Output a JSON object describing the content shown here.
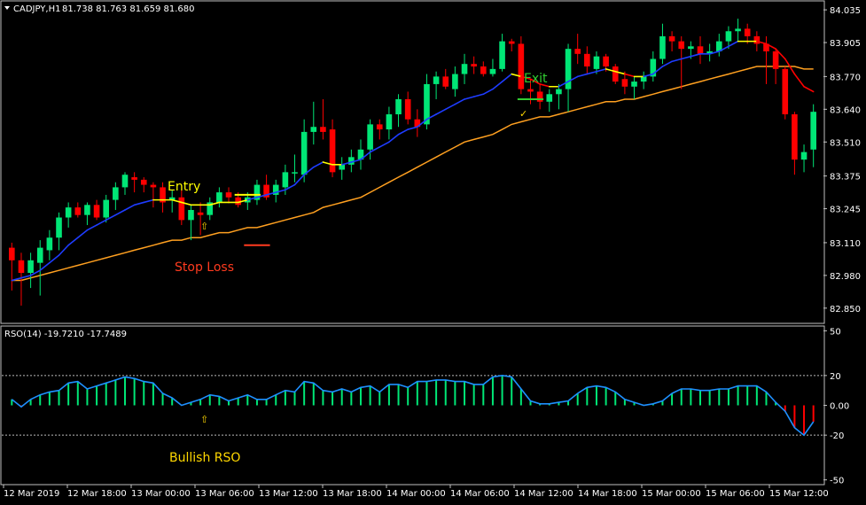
{
  "header": {
    "symbol": "CADJPY,H1",
    "ohlc": "81.738 81.763 81.659 81.680"
  },
  "indicator": {
    "title": "RSO(14) -19.7210 -17.7489"
  },
  "annotations": {
    "entry": "Entry",
    "exit": "Exit",
    "stop_loss": "Stop Loss",
    "bullish_rso": "Bullish RSO",
    "arrow_glyph": "⇧",
    "check_glyph": "✓"
  },
  "colors": {
    "background": "#000000",
    "bull": "#00E676",
    "bear": "#FF0000",
    "ma_fast_up": "#1E3CFF",
    "ma_fast_flat": "#FFFF00",
    "ma_fast_down": "#FF0000",
    "ma_slow": "#FFA020",
    "rso_line": "#1E90FF",
    "axis_text": "#FFFFFF",
    "entry_text": "#FFFF00",
    "exit_text": "#32CD32",
    "stop_text": "#FF3B1F",
    "bullish_rso_text": "#FFD700"
  },
  "chart_data": [
    {
      "type": "candlestick",
      "title": "CADJPY,H1 81.738 81.763 81.659 81.680",
      "y_ticks": [
        "84.035",
        "83.905",
        "83.770",
        "83.640",
        "83.510",
        "83.375",
        "83.245",
        "83.110",
        "82.980",
        "82.850"
      ],
      "ylim": [
        82.8,
        84.06
      ],
      "x_ticks": [
        "12 Mar 2019",
        "12 Mar 18:00",
        "13 Mar 00:00",
        "13 Mar 06:00",
        "13 Mar 12:00",
        "13 Mar 18:00",
        "14 Mar 00:00",
        "14 Mar 06:00",
        "14 Mar 12:00",
        "14 Mar 18:00",
        "15 Mar 00:00",
        "15 Mar 06:00",
        "15 Mar 12:00"
      ],
      "candles": [
        {
          "o": 83.09,
          "h": 83.11,
          "l": 82.92,
          "c": 83.04
        },
        {
          "o": 83.04,
          "h": 83.07,
          "l": 82.86,
          "c": 82.99
        },
        {
          "o": 82.99,
          "h": 83.07,
          "l": 82.93,
          "c": 83.04
        },
        {
          "o": 83.03,
          "h": 83.12,
          "l": 82.9,
          "c": 83.09
        },
        {
          "o": 83.08,
          "h": 83.16,
          "l": 83.04,
          "c": 83.13
        },
        {
          "o": 83.13,
          "h": 83.23,
          "l": 83.08,
          "c": 83.21
        },
        {
          "o": 83.21,
          "h": 83.27,
          "l": 83.17,
          "c": 83.25
        },
        {
          "o": 83.25,
          "h": 83.27,
          "l": 83.21,
          "c": 83.22
        },
        {
          "o": 83.22,
          "h": 83.27,
          "l": 83.18,
          "c": 83.26
        },
        {
          "o": 83.26,
          "h": 83.28,
          "l": 83.2,
          "c": 83.21
        },
        {
          "o": 83.21,
          "h": 83.3,
          "l": 83.19,
          "c": 83.28
        },
        {
          "o": 83.28,
          "h": 83.35,
          "l": 83.24,
          "c": 83.33
        },
        {
          "o": 83.33,
          "h": 83.39,
          "l": 83.3,
          "c": 83.38
        },
        {
          "o": 83.37,
          "h": 83.39,
          "l": 83.31,
          "c": 83.36
        },
        {
          "o": 83.36,
          "h": 83.37,
          "l": 83.31,
          "c": 83.34
        },
        {
          "o": 83.34,
          "h": 83.35,
          "l": 83.25,
          "c": 83.33
        },
        {
          "o": 83.33,
          "h": 83.35,
          "l": 83.23,
          "c": 83.27
        },
        {
          "o": 83.28,
          "h": 83.32,
          "l": 83.23,
          "c": 83.29
        },
        {
          "o": 83.29,
          "h": 83.32,
          "l": 83.18,
          "c": 83.2
        },
        {
          "o": 83.2,
          "h": 83.26,
          "l": 83.12,
          "c": 83.24
        },
        {
          "o": 83.23,
          "h": 83.27,
          "l": 83.14,
          "c": 83.22
        },
        {
          "o": 83.22,
          "h": 83.29,
          "l": 83.2,
          "c": 83.27
        },
        {
          "o": 83.27,
          "h": 83.33,
          "l": 83.25,
          "c": 83.31
        },
        {
          "o": 83.31,
          "h": 83.33,
          "l": 83.27,
          "c": 83.29
        },
        {
          "o": 83.29,
          "h": 83.31,
          "l": 83.25,
          "c": 83.26
        },
        {
          "o": 83.27,
          "h": 83.31,
          "l": 83.24,
          "c": 83.29
        },
        {
          "o": 83.28,
          "h": 83.36,
          "l": 83.26,
          "c": 83.34
        },
        {
          "o": 83.34,
          "h": 83.38,
          "l": 83.28,
          "c": 83.29
        },
        {
          "o": 83.3,
          "h": 83.36,
          "l": 83.27,
          "c": 83.34
        },
        {
          "o": 83.33,
          "h": 83.42,
          "l": 83.3,
          "c": 83.39
        },
        {
          "o": 83.39,
          "h": 83.46,
          "l": 83.35,
          "c": 83.39
        },
        {
          "o": 83.38,
          "h": 83.6,
          "l": 83.35,
          "c": 83.55
        },
        {
          "o": 83.55,
          "h": 83.67,
          "l": 83.5,
          "c": 83.57
        },
        {
          "o": 83.57,
          "h": 83.68,
          "l": 83.52,
          "c": 83.55
        },
        {
          "o": 83.56,
          "h": 83.6,
          "l": 83.37,
          "c": 83.39
        },
        {
          "o": 83.4,
          "h": 83.45,
          "l": 83.36,
          "c": 83.42
        },
        {
          "o": 83.42,
          "h": 83.48,
          "l": 83.39,
          "c": 83.45
        },
        {
          "o": 83.44,
          "h": 83.52,
          "l": 83.4,
          "c": 83.48
        },
        {
          "o": 83.48,
          "h": 83.6,
          "l": 83.44,
          "c": 83.58
        },
        {
          "o": 83.58,
          "h": 83.6,
          "l": 83.52,
          "c": 83.56
        },
        {
          "o": 83.56,
          "h": 83.65,
          "l": 83.52,
          "c": 83.62
        },
        {
          "o": 83.62,
          "h": 83.7,
          "l": 83.57,
          "c": 83.68
        },
        {
          "o": 83.68,
          "h": 83.71,
          "l": 83.58,
          "c": 83.6
        },
        {
          "o": 83.6,
          "h": 83.64,
          "l": 83.53,
          "c": 83.57
        },
        {
          "o": 83.58,
          "h": 83.78,
          "l": 83.56,
          "c": 83.74
        },
        {
          "o": 83.74,
          "h": 83.79,
          "l": 83.68,
          "c": 83.77
        },
        {
          "o": 83.77,
          "h": 83.8,
          "l": 83.72,
          "c": 83.73
        },
        {
          "o": 83.72,
          "h": 83.81,
          "l": 83.69,
          "c": 83.78
        },
        {
          "o": 83.78,
          "h": 83.86,
          "l": 83.74,
          "c": 83.82
        },
        {
          "o": 83.82,
          "h": 83.85,
          "l": 83.78,
          "c": 83.81
        },
        {
          "o": 83.81,
          "h": 83.83,
          "l": 83.77,
          "c": 83.78
        },
        {
          "o": 83.78,
          "h": 83.84,
          "l": 83.77,
          "c": 83.8
        },
        {
          "o": 83.8,
          "h": 83.94,
          "l": 83.79,
          "c": 83.91
        },
        {
          "o": 83.91,
          "h": 83.92,
          "l": 83.87,
          "c": 83.9
        },
        {
          "o": 83.9,
          "h": 83.93,
          "l": 83.7,
          "c": 83.72
        },
        {
          "o": 83.72,
          "h": 83.76,
          "l": 83.66,
          "c": 83.71
        },
        {
          "o": 83.71,
          "h": 83.74,
          "l": 83.64,
          "c": 83.67
        },
        {
          "o": 83.67,
          "h": 83.72,
          "l": 83.63,
          "c": 83.7
        },
        {
          "o": 83.7,
          "h": 83.74,
          "l": 83.64,
          "c": 83.72
        },
        {
          "o": 83.72,
          "h": 83.9,
          "l": 83.63,
          "c": 83.88
        },
        {
          "o": 83.88,
          "h": 83.94,
          "l": 83.82,
          "c": 83.86
        },
        {
          "o": 83.86,
          "h": 83.89,
          "l": 83.78,
          "c": 83.81
        },
        {
          "o": 83.8,
          "h": 83.87,
          "l": 83.78,
          "c": 83.85
        },
        {
          "o": 83.85,
          "h": 83.86,
          "l": 83.79,
          "c": 83.81
        },
        {
          "o": 83.81,
          "h": 83.82,
          "l": 83.74,
          "c": 83.75
        },
        {
          "o": 83.76,
          "h": 83.79,
          "l": 83.7,
          "c": 83.73
        },
        {
          "o": 83.73,
          "h": 83.77,
          "l": 83.68,
          "c": 83.75
        },
        {
          "o": 83.75,
          "h": 83.79,
          "l": 83.72,
          "c": 83.77
        },
        {
          "o": 83.77,
          "h": 83.87,
          "l": 83.75,
          "c": 83.84
        },
        {
          "o": 83.84,
          "h": 83.98,
          "l": 83.82,
          "c": 83.93
        },
        {
          "o": 83.93,
          "h": 83.95,
          "l": 83.87,
          "c": 83.91
        },
        {
          "o": 83.91,
          "h": 83.93,
          "l": 83.72,
          "c": 83.88
        },
        {
          "o": 83.88,
          "h": 83.91,
          "l": 83.84,
          "c": 83.89
        },
        {
          "o": 83.89,
          "h": 83.93,
          "l": 83.82,
          "c": 83.86
        },
        {
          "o": 83.86,
          "h": 83.9,
          "l": 83.83,
          "c": 83.87
        },
        {
          "o": 83.87,
          "h": 83.94,
          "l": 83.85,
          "c": 83.91
        },
        {
          "o": 83.91,
          "h": 83.97,
          "l": 83.88,
          "c": 83.95
        },
        {
          "o": 83.95,
          "h": 84.0,
          "l": 83.91,
          "c": 83.96
        },
        {
          "o": 83.96,
          "h": 83.98,
          "l": 83.9,
          "c": 83.93
        },
        {
          "o": 83.93,
          "h": 83.95,
          "l": 83.87,
          "c": 83.9
        },
        {
          "o": 83.9,
          "h": 83.93,
          "l": 83.74,
          "c": 83.87
        },
        {
          "o": 83.87,
          "h": 83.88,
          "l": 83.74,
          "c": 83.8
        },
        {
          "o": 83.8,
          "h": 83.81,
          "l": 83.6,
          "c": 83.62
        },
        {
          "o": 83.62,
          "h": 83.63,
          "l": 83.38,
          "c": 83.44
        },
        {
          "o": 83.44,
          "h": 83.5,
          "l": 83.39,
          "c": 83.47
        },
        {
          "o": 83.48,
          "h": 83.66,
          "l": 83.41,
          "c": 83.63
        }
      ],
      "ma_fast": [
        82.96,
        82.97,
        82.98,
        83.0,
        83.03,
        83.06,
        83.1,
        83.13,
        83.16,
        83.18,
        83.2,
        83.22,
        83.24,
        83.26,
        83.27,
        83.28,
        83.28,
        83.28,
        83.27,
        83.26,
        83.26,
        83.26,
        83.27,
        83.27,
        83.27,
        83.28,
        83.29,
        83.3,
        83.31,
        83.32,
        83.34,
        83.38,
        83.41,
        83.43,
        83.42,
        83.42,
        83.43,
        83.44,
        83.47,
        83.49,
        83.51,
        83.54,
        83.56,
        83.57,
        83.6,
        83.62,
        83.64,
        83.66,
        83.68,
        83.69,
        83.7,
        83.72,
        83.75,
        83.78,
        83.77,
        83.76,
        83.74,
        83.73,
        83.73,
        83.75,
        83.77,
        83.78,
        83.79,
        83.8,
        83.79,
        83.78,
        83.77,
        83.77,
        83.78,
        83.81,
        83.83,
        83.84,
        83.85,
        83.86,
        83.86,
        83.87,
        83.89,
        83.91,
        83.91,
        83.91,
        83.9,
        83.88,
        83.84,
        83.78,
        83.73,
        83.71
      ],
      "ma_fast_trend": [
        "up",
        "up",
        "up",
        "up",
        "up",
        "up",
        "up",
        "up",
        "up",
        "up",
        "up",
        "up",
        "up",
        "up",
        "up",
        "up",
        "flat",
        "flat",
        "flat",
        "flat",
        "flat",
        "flat",
        "flat",
        "flat",
        "flat",
        "flat",
        "up",
        "up",
        "up",
        "up",
        "up",
        "up",
        "up",
        "up",
        "flat",
        "flat",
        "up",
        "up",
        "up",
        "up",
        "up",
        "up",
        "up",
        "up",
        "up",
        "up",
        "up",
        "up",
        "up",
        "up",
        "up",
        "up",
        "up",
        "up",
        "flat",
        "down",
        "down",
        "down",
        "flat",
        "up",
        "up",
        "up",
        "up",
        "up",
        "flat",
        "flat",
        "down",
        "flat",
        "up",
        "up",
        "up",
        "up",
        "up",
        "up",
        "up",
        "up",
        "up",
        "up",
        "flat",
        "flat",
        "down",
        "down",
        "down",
        "down",
        "down",
        "down"
      ],
      "ma_slow": [
        82.96,
        82.96,
        82.97,
        82.98,
        82.99,
        83.0,
        83.01,
        83.02,
        83.03,
        83.04,
        83.05,
        83.06,
        83.07,
        83.08,
        83.09,
        83.1,
        83.11,
        83.12,
        83.12,
        83.13,
        83.13,
        83.14,
        83.15,
        83.15,
        83.16,
        83.17,
        83.17,
        83.18,
        83.19,
        83.2,
        83.21,
        83.22,
        83.23,
        83.25,
        83.26,
        83.27,
        83.28,
        83.29,
        83.31,
        83.33,
        83.35,
        83.37,
        83.39,
        83.41,
        83.43,
        83.45,
        83.47,
        83.49,
        83.51,
        83.52,
        83.53,
        83.54,
        83.56,
        83.58,
        83.59,
        83.6,
        83.61,
        83.61,
        83.62,
        83.63,
        83.64,
        83.65,
        83.66,
        83.67,
        83.67,
        83.68,
        83.68,
        83.69,
        83.7,
        83.71,
        83.72,
        83.73,
        83.74,
        83.75,
        83.76,
        83.77,
        83.78,
        83.79,
        83.8,
        83.81,
        83.81,
        83.81,
        83.81,
        83.81,
        83.8,
        83.8
      ],
      "annotation_lines": [
        {
          "label": "entry",
          "price": 83.3,
          "from": 24,
          "to": 26,
          "color": "#FFFF00"
        },
        {
          "label": "stop_loss",
          "price": 83.1,
          "from": 25,
          "to": 27,
          "color": "#FF3B1F"
        },
        {
          "label": "exit",
          "price": 83.68,
          "from": 54,
          "to": 56,
          "color": "#32CD32"
        }
      ]
    },
    {
      "type": "bar",
      "title": "RSO(14) -19.7210 -17.7489",
      "ylim": [
        -52,
        52
      ],
      "y_ticks": [
        "50",
        "20",
        "0.00",
        "-20",
        "-50"
      ],
      "levels": [
        20,
        -20
      ],
      "values": [
        4,
        -1,
        4,
        7,
        9,
        10,
        15,
        16,
        11,
        13,
        15,
        17,
        19,
        18,
        16,
        15,
        8,
        5,
        0,
        2,
        4,
        7,
        6,
        3,
        5,
        7,
        4,
        4,
        7,
        10,
        9,
        16,
        15,
        10,
        9,
        11,
        9,
        12,
        13,
        9,
        14,
        14,
        12,
        16,
        16,
        17,
        17,
        16,
        16,
        14,
        14,
        19,
        20,
        19,
        11,
        3,
        1,
        1,
        2,
        3,
        8,
        12,
        13,
        12,
        9,
        4,
        2,
        0,
        1,
        3,
        8,
        11,
        11,
        10,
        10,
        11,
        11,
        13,
        13,
        13,
        9,
        2,
        -4,
        -15,
        -20,
        -11,
        1,
        -8
      ],
      "colors_by_sign": {
        "positive": "#00E676",
        "negative": "#FF0000"
      }
    }
  ]
}
